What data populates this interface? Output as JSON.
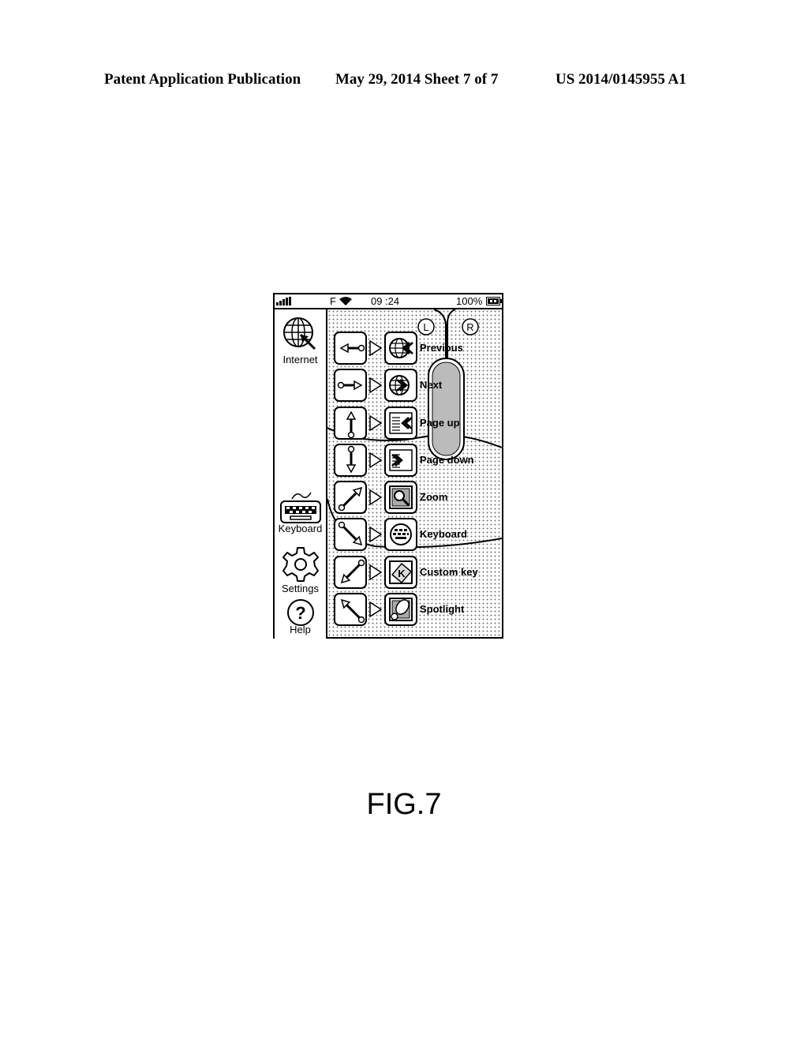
{
  "header": {
    "left": "Patent Application Publication",
    "middle": "May 29, 2014  Sheet 7 of 7",
    "right": "US 2014/0145955 A1"
  },
  "phone": {
    "status_bar": {
      "signal_icon": "signal-bars-icon",
      "carrier": "F",
      "wifi_icon": "wifi-icon",
      "time": "09 :24",
      "battery": "100%",
      "battery_icon": "battery-icon"
    },
    "sidebar": [
      {
        "label": "Internet",
        "icon": "globe-cursor-icon"
      },
      {
        "label": "Keyboard",
        "icon": "keyboard-icon"
      },
      {
        "label": "Settings",
        "icon": "gear-icon"
      },
      {
        "label": "Help",
        "icon": "question-icon"
      }
    ],
    "mouse_buttons": {
      "left": "L",
      "right": "R"
    },
    "gestures": [
      {
        "gesture": "swipe-left",
        "action_icon": "globe-back-icon",
        "label": "Previous"
      },
      {
        "gesture": "swipe-right",
        "action_icon": "globe-forward-icon",
        "label": "Next"
      },
      {
        "gesture": "swipe-up",
        "action_icon": "page-up-icon",
        "label": "Page up"
      },
      {
        "gesture": "swipe-down",
        "action_icon": "page-down-icon",
        "label": "Page down"
      },
      {
        "gesture": "swipe-up-right",
        "action_icon": "zoom-icon",
        "label": "Zoom"
      },
      {
        "gesture": "swipe-down-right",
        "action_icon": "keyboard-icon",
        "label": "Keyboard"
      },
      {
        "gesture": "swipe-down-left",
        "action_icon": "custom-key-icon",
        "label": "Custom key"
      },
      {
        "gesture": "swipe-up-left",
        "action_icon": "spotlight-icon",
        "label": "Spotlight"
      }
    ]
  },
  "figure_label": "FIG.7"
}
